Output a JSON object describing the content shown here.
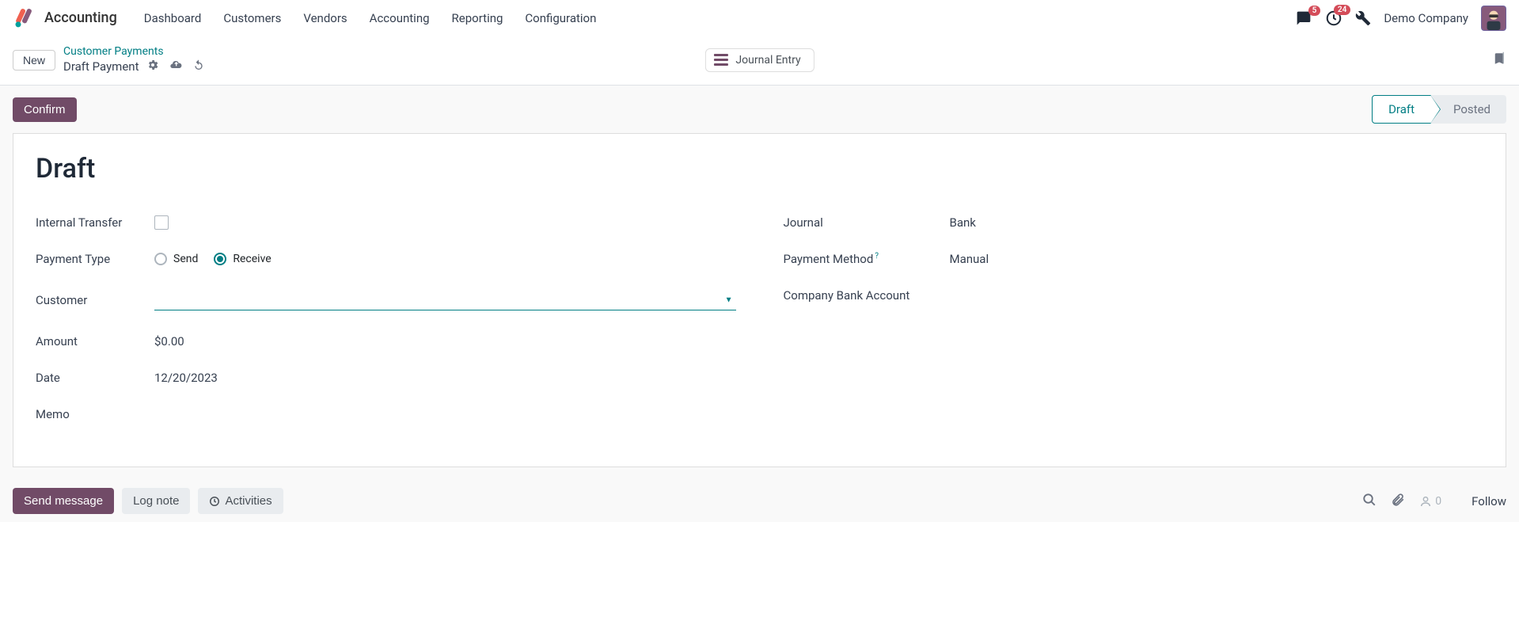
{
  "navbar": {
    "app_name": "Accounting",
    "items": [
      "Dashboard",
      "Customers",
      "Vendors",
      "Accounting",
      "Reporting",
      "Configuration"
    ],
    "messages_badge": "5",
    "activities_badge": "24",
    "company": "Demo Company"
  },
  "controlbar": {
    "new_label": "New",
    "breadcrumb_parent": "Customer Payments",
    "breadcrumb_current": "Draft Payment",
    "toggle_label": "Journal Entry"
  },
  "actionbar": {
    "confirm_label": "Confirm",
    "status": {
      "draft": "Draft",
      "posted": "Posted"
    }
  },
  "form": {
    "title": "Draft",
    "labels": {
      "internal_transfer": "Internal Transfer",
      "payment_type": "Payment Type",
      "customer": "Customer",
      "amount": "Amount",
      "date": "Date",
      "memo": "Memo",
      "journal": "Journal",
      "payment_method": "Payment Method",
      "company_bank": "Company Bank Account"
    },
    "payment_type": {
      "send": "Send",
      "receive": "Receive",
      "selected": "receive"
    },
    "customer": "",
    "amount": "$0.00",
    "date": "12/20/2023",
    "memo": "",
    "journal": "Bank",
    "payment_method": "Manual",
    "company_bank": "",
    "help_mark": "?"
  },
  "chatter": {
    "send": "Send message",
    "log": "Log note",
    "activities": "Activities",
    "followers_count": "0",
    "follow": "Follow"
  }
}
